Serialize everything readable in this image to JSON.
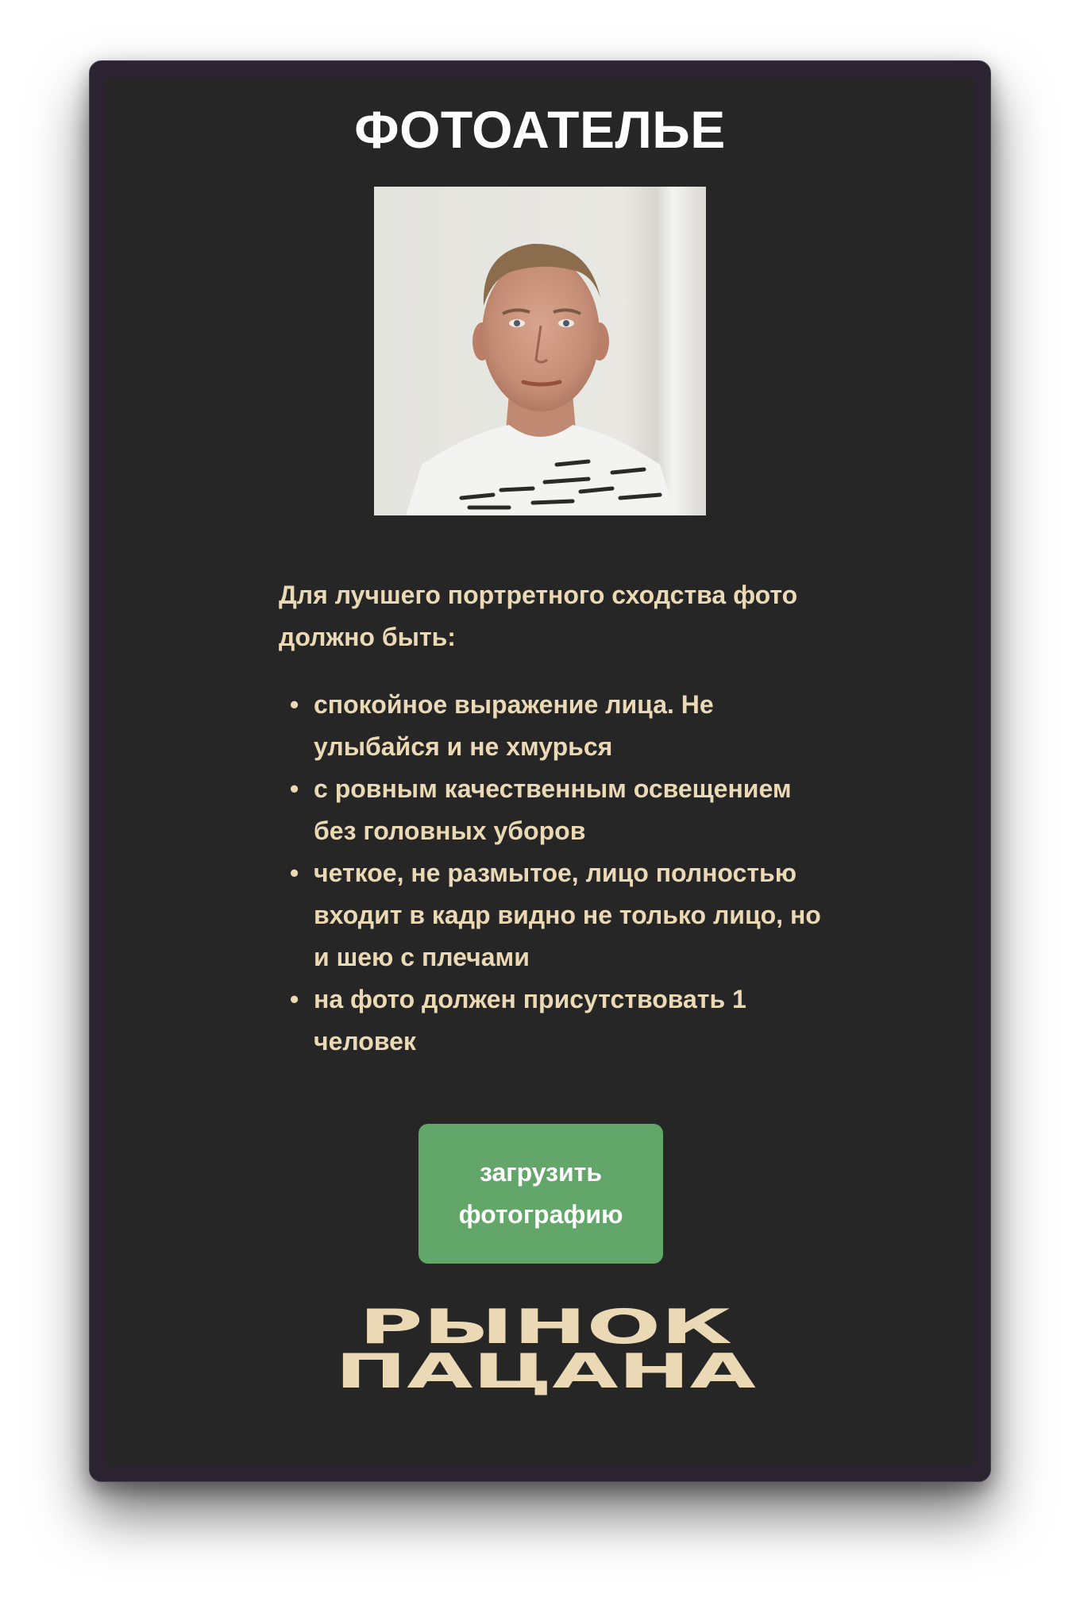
{
  "app": {
    "title": "ФОТОАТЕЛЬЕ"
  },
  "photo": {
    "alt": "Портрет мужчины в белой футболке"
  },
  "requirements": {
    "intro": "Для лучшего портретного сходства фото должно быть:",
    "items": [
      "спокойное выражение лица. Не улыбайся и не хмурься",
      "с ровным качественным освещением без головных уборов",
      "четкое, не размытое, лицо полностью входит в кадр видно не только лицо, но и шею с плечами",
      "на фото должен присутствовать 1 человек"
    ]
  },
  "upload_button": {
    "label": "загрузить фотографию"
  },
  "logo": {
    "line1": "РЫНОК",
    "line2": "ПАЦАНА"
  },
  "colors": {
    "window_border": "#2b2430",
    "card_background": "#262626",
    "accent_text": "#ead9b4",
    "button_green": "#63a66a",
    "title_text": "#ffffff"
  }
}
